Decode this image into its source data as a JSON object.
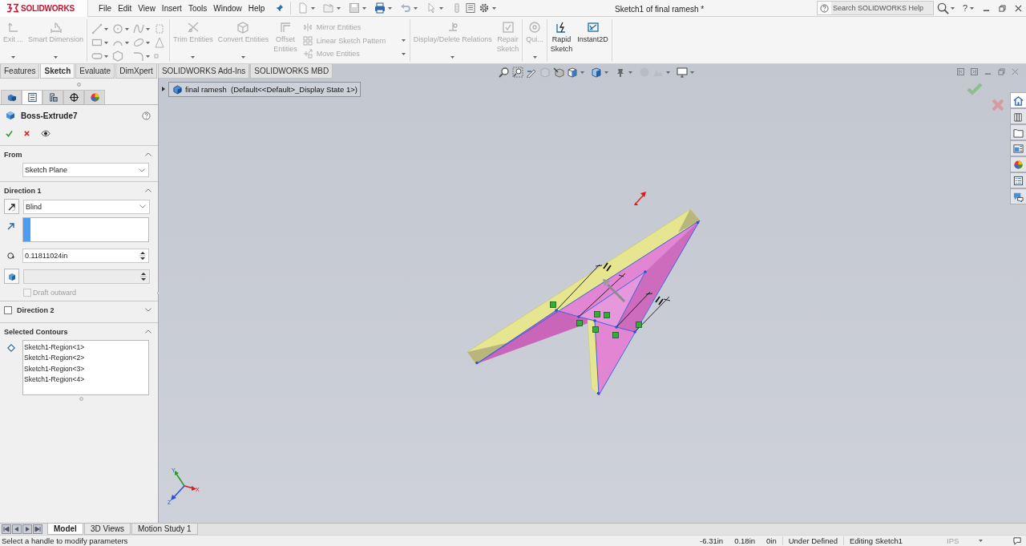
{
  "app": {
    "brand": "SOLIDWORKS"
  },
  "menu": [
    "File",
    "Edit",
    "View",
    "Insert",
    "Tools",
    "Window",
    "Help"
  ],
  "window": {
    "title": "Sketch1 of final ramesh *"
  },
  "help_search": {
    "placeholder": "Search SOLIDWORKS Help"
  },
  "help_menu": "?",
  "ribbon": {
    "groups": [
      {
        "kind": "buttons",
        "items": [
          {
            "kind": "large",
            "label": "Exit ...",
            "disabled": true,
            "dropdown": true
          },
          {
            "kind": "large",
            "label": "Smart Dimension",
            "disabled": true,
            "dropdown": true
          }
        ]
      },
      {
        "kind": "tools"
      },
      {
        "kind": "buttons",
        "items": [
          {
            "kind": "large",
            "label": "Trim Entities",
            "disabled": true,
            "dropdown": true
          },
          {
            "kind": "large",
            "label": "Convert Entities",
            "disabled": true,
            "dropdown": true
          },
          {
            "kind": "large",
            "label": "Offset Entities",
            "disabled": true,
            "dropdown": false
          },
          {
            "kind": "stack",
            "items": [
              {
                "label": "Mirror Entities",
                "disabled": true,
                "dropdown": false
              },
              {
                "label": "Linear Sketch Pattern",
                "disabled": true,
                "dropdown": true
              },
              {
                "label": "Move Entities",
                "disabled": true,
                "dropdown": true
              }
            ]
          }
        ]
      },
      {
        "kind": "buttons",
        "items": [
          {
            "kind": "large",
            "label": "Display/Delete Relations",
            "disabled": true,
            "dropdown": true
          },
          {
            "kind": "large",
            "label": "Repair Sketch",
            "disabled": true,
            "dropdown": false
          }
        ]
      },
      {
        "kind": "buttons",
        "items": [
          {
            "kind": "large",
            "label": "Qui...",
            "disabled": true,
            "dropdown": true
          }
        ]
      },
      {
        "kind": "buttons",
        "items": [
          {
            "kind": "large",
            "label": "Rapid Sketch",
            "disabled": false,
            "dropdown": false
          },
          {
            "kind": "large",
            "label": "Instant2D",
            "disabled": false,
            "dropdown": false
          }
        ]
      }
    ]
  },
  "command_tabs": [
    {
      "label": "Features",
      "selected": false
    },
    {
      "label": "Sketch",
      "selected": true
    },
    {
      "label": "Evaluate",
      "selected": false
    },
    {
      "label": "DimXpert",
      "selected": false
    },
    {
      "label": "SOLIDWORKS Add-Ins",
      "selected": false
    },
    {
      "label": "SOLIDWORKS MBD",
      "selected": false
    }
  ],
  "manager_tabs": [
    {
      "selected": false
    },
    {
      "selected": true
    },
    {
      "selected": false
    },
    {
      "selected": false
    },
    {
      "selected": false
    }
  ],
  "property_manager": {
    "title": "Boss-Extrude7",
    "sections": [
      {
        "kind": "from",
        "title": "From",
        "expanded": true,
        "value": "Sketch Plane"
      },
      {
        "kind": "direction",
        "title": "Direction 1",
        "expanded": true,
        "end_condition": "Blind",
        "depth": "0.11811024in",
        "angle_disabled": true,
        "draft": {
          "label": "Draft outward",
          "checked": false,
          "disabled": true
        }
      },
      {
        "kind": "optional",
        "title": "Direction 2",
        "expanded": false,
        "checked": false
      },
      {
        "kind": "contours",
        "title": "Selected Contours",
        "expanded": true,
        "items": [
          "Sketch1-Region<1>",
          "Sketch1-Region<2>",
          "Sketch1-Region<3>",
          "Sketch1-Region<4>"
        ]
      }
    ]
  },
  "viewport": {
    "tree_flyout": {
      "expanded": false,
      "label": "final ramesh  (Default<<Default>_Display State 1>)"
    },
    "triad_labels": [
      "Y",
      "X",
      "Z"
    ],
    "task_pane_tabs": [
      {
        "selected": true
      },
      {
        "selected": false
      },
      {
        "selected": false
      },
      {
        "selected": false
      },
      {
        "selected": false
      },
      {
        "selected": false
      },
      {
        "selected": false
      }
    ]
  },
  "bottom_tabs": [
    {
      "label": "Model",
      "selected": true
    },
    {
      "label": "3D Views",
      "selected": false
    },
    {
      "label": "Motion Study 1",
      "selected": false
    }
  ],
  "status_bar": {
    "message": "Select a handle to modify parameters",
    "fields": [
      "-6.31in",
      "0.18in",
      "0in",
      "Under Defined",
      "Editing Sketch1"
    ],
    "units": "IPS"
  }
}
